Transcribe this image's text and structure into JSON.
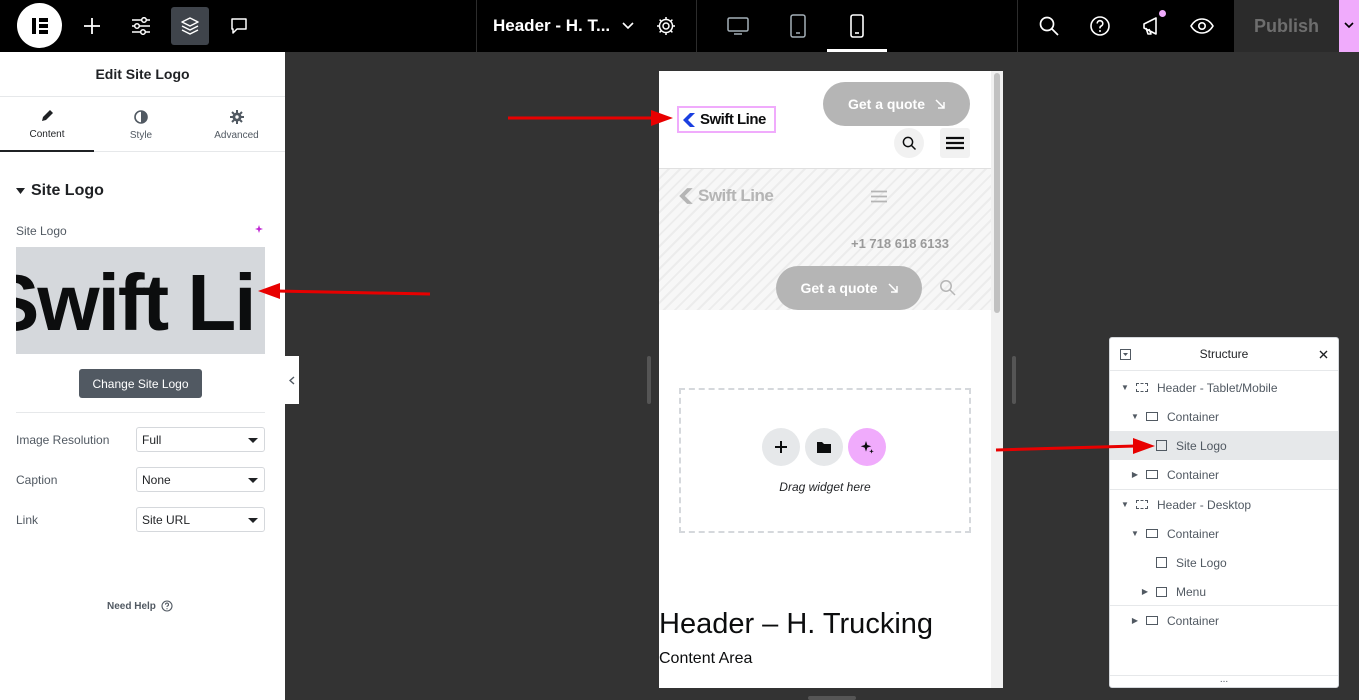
{
  "topbar": {
    "document_title": "Header - H. T...",
    "publish_label": "Publish"
  },
  "panel": {
    "title": "Edit Site Logo",
    "tabs": [
      {
        "label": "Content",
        "icon": "pencil-icon"
      },
      {
        "label": "Style",
        "icon": "half-circle-icon"
      },
      {
        "label": "Advanced",
        "icon": "gear-icon"
      }
    ],
    "section_title": "Site Logo",
    "site_logo_label": "Site Logo",
    "logo_preview_text": "Swift Li",
    "change_button": "Change Site Logo",
    "fields": [
      {
        "label": "Image Resolution",
        "value": "Full"
      },
      {
        "label": "Caption",
        "value": "None"
      },
      {
        "label": "Link",
        "value": "Site URL"
      }
    ],
    "need_help": "Need Help"
  },
  "preview": {
    "get_quote": "Get a quote",
    "brand_name": "Swift Line",
    "phone": "+1 718 618 6133",
    "drag_widget": "Drag widget here",
    "page_title": "Header – H. Trucking",
    "content_area": "Content Area"
  },
  "structure": {
    "title": "Structure",
    "items": [
      {
        "label": "Header - Tablet/Mobile"
      },
      {
        "label": "Container"
      },
      {
        "label": "Site Logo"
      },
      {
        "label": "Container"
      },
      {
        "label": "Header - Desktop"
      },
      {
        "label": "Container"
      },
      {
        "label": "Site Logo"
      },
      {
        "label": "Menu"
      },
      {
        "label": "Container"
      }
    ],
    "footer": "..."
  },
  "colors": {
    "accent_pink": "#f0abfc",
    "annotation_red": "#e80000",
    "brand_blue": "#1a3fe0"
  }
}
